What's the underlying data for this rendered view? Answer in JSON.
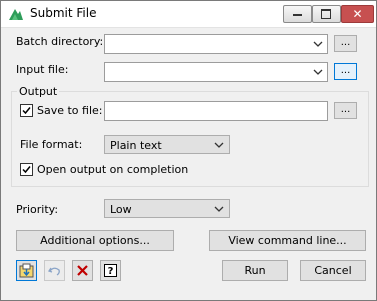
{
  "window": {
    "title": "Submit File",
    "close_glyph": "✕"
  },
  "fields": {
    "batch_directory_label": "Batch directory:",
    "batch_directory_value": "",
    "input_file_label": "Input file:",
    "input_file_value": "",
    "browse_label": "..."
  },
  "output": {
    "group_label": "Output",
    "save_to_file_label": "Save to file:",
    "save_to_file_checked": true,
    "save_to_file_value": "",
    "file_format_label": "File format:",
    "file_format_value": "Plain text",
    "open_on_completion_label": "Open output on completion",
    "open_on_completion_checked": true
  },
  "priority": {
    "label": "Priority:",
    "value": "Low"
  },
  "buttons": {
    "additional_options": "Additional options...",
    "view_command_line": "View command line...",
    "run": "Run",
    "cancel": "Cancel"
  },
  "toolbar": {
    "icons": [
      "save-icon",
      "undo-icon",
      "clear-icon",
      "help-icon"
    ],
    "help_glyph": "?"
  },
  "colors": {
    "accent": "#0078d7",
    "close_red": "#c75050",
    "clear_red": "#c00000"
  }
}
